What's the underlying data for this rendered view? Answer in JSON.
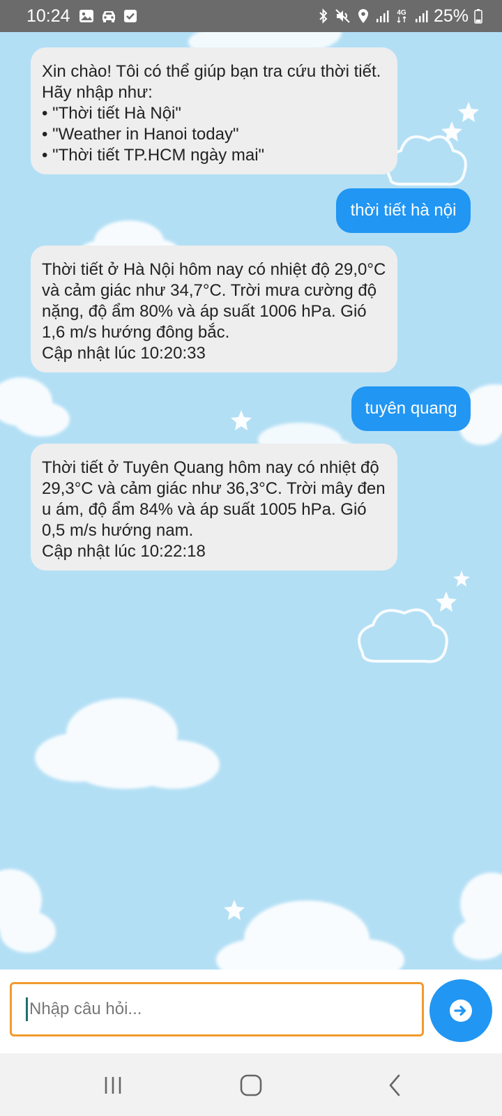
{
  "status_bar": {
    "time": "10:24",
    "battery_text": "25%",
    "network_label": "4G",
    "icons": [
      "gallery-icon",
      "car-icon",
      "checkbox-icon",
      "bluetooth-icon",
      "mute-icon",
      "location-icon",
      "signal-icon",
      "network-4g-icon",
      "signal-icon",
      "battery-icon"
    ]
  },
  "messages": [
    {
      "sender": "bot",
      "text": "Xin chào! Tôi có thể giúp bạn tra cứu thời tiết. Hãy nhập như:\n• \"Thời tiết Hà Nội\"\n• \"Weather in Hanoi today\"\n• \"Thời tiết TP.HCM ngày mai\""
    },
    {
      "sender": "user",
      "text": "thời tiết hà nội"
    },
    {
      "sender": "bot",
      "text": "Thời tiết ở Hà Nội hôm nay có nhiệt độ 29,0°C và cảm giác như 34,7°C. Trời mưa cường độ nặng, độ ẩm 80% và áp suất 1006 hPa. Gió 1,6 m/s hướng đông bắc.\nCập nhật lúc 10:20:33"
    },
    {
      "sender": "user",
      "text": "tuyên quang"
    },
    {
      "sender": "bot",
      "text": "Thời tiết ở Tuyên Quang hôm nay có nhiệt độ 29,3°C và cảm giác như 36,3°C. Trời mây đen u ám, độ ẩm 84% và áp suất 1005 hPa. Gió 0,5 m/s hướng nam.\nCập nhật lúc 10:22:18"
    }
  ],
  "input": {
    "placeholder": "Nhập câu hỏi...",
    "value": ""
  },
  "send_button": {
    "icon": "arrow-right-icon"
  },
  "nav_bar": {
    "icons": [
      "recent-apps-icon",
      "home-icon",
      "back-icon"
    ]
  },
  "colors": {
    "background": "#b3dff5",
    "bot_bubble": "#eeeeee",
    "user_bubble": "#2196f3",
    "input_border": "#f29a2e",
    "send_button": "#2196f3",
    "status_bar": "#6b6b6b"
  }
}
